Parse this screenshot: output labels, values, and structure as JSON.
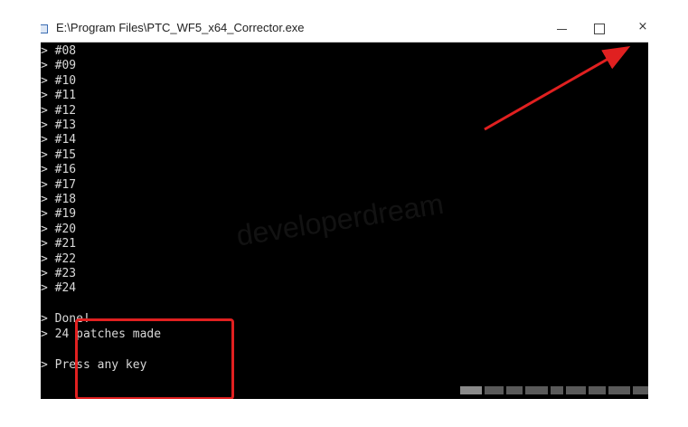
{
  "window": {
    "title": "E:\\Program Files\\PTC_WF5_x64_Corrector.exe",
    "app_icon": "console-app-icon",
    "controls": {
      "minimize_icon": "minimize-icon",
      "maximize_icon": "maximize-icon",
      "close_icon": "close-icon",
      "close_glyph": "×"
    }
  },
  "console": {
    "prompt": ">",
    "patch_lines": [
      "#08",
      "#09",
      "#10",
      "#11",
      "#12",
      "#13",
      "#14",
      "#15",
      "#16",
      "#17",
      "#18",
      "#19",
      "#20",
      "#21",
      "#22",
      "#23",
      "#24"
    ],
    "summary": {
      "done": "Done!",
      "patches": "24 patches made",
      "press_key": "Press any key"
    }
  },
  "watermark": "developerdream",
  "colors": {
    "console_bg": "#000000",
    "console_text": "#d8d8d8",
    "highlight": "#e02020",
    "arrow": "#e02020"
  }
}
